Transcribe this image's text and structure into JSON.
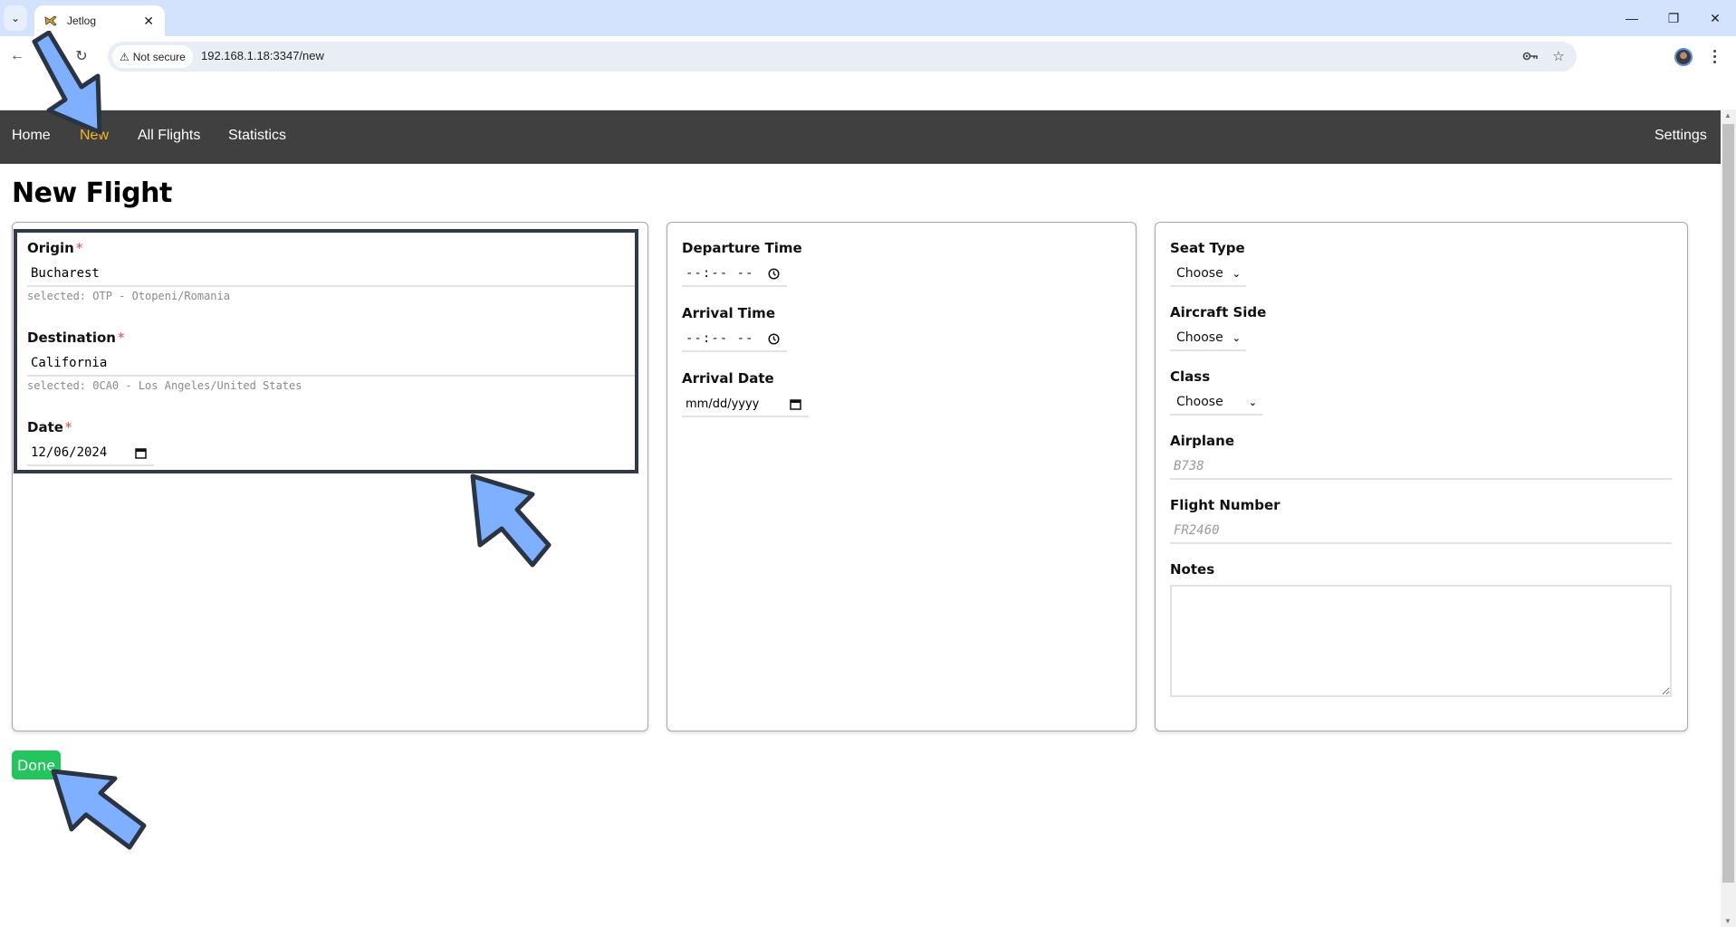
{
  "browser": {
    "tab_title": "Jetlog",
    "security_label": "Not secure",
    "url": "192.168.1.18:3347/new",
    "icons": {
      "tab_search": "chevron-down-icon",
      "tab_close": "close-icon",
      "back": "arrow-left-icon",
      "reload": "reload-icon",
      "security": "warning-triangle-icon",
      "password": "key-icon",
      "bookmark": "star-icon",
      "profile": "avatar",
      "menu": "kebab-menu-icon",
      "minimize": "minimize-icon",
      "restore": "restore-icon",
      "close_window": "close-icon"
    }
  },
  "navbar": {
    "links": [
      {
        "label": "Home",
        "active": false
      },
      {
        "label": "New",
        "active": true
      },
      {
        "label": "All Flights",
        "active": false
      },
      {
        "label": "Statistics",
        "active": false
      }
    ],
    "settings_label": "Settings",
    "active_color": "#f5b722",
    "background_color": "#404040"
  },
  "page": {
    "title": "New Flight"
  },
  "form": {
    "origin": {
      "label": "Origin",
      "required_mark": "*",
      "value": "Bucharest",
      "selected_hint": "selected: OTP - Otopeni/Romania"
    },
    "destination": {
      "label": "Destination",
      "required_mark": "*",
      "value": "California",
      "selected_hint": "selected: 0CA0 - Los Angeles/United States"
    },
    "date": {
      "label": "Date",
      "required_mark": "*",
      "value": "12/06/2024"
    },
    "departure_time": {
      "label": "Departure Time",
      "placeholder": "--:-- --"
    },
    "arrival_time": {
      "label": "Arrival Time",
      "placeholder": "--:-- --"
    },
    "arrival_date": {
      "label": "Arrival Date",
      "placeholder": "mm/dd/yyyy"
    },
    "seat_type": {
      "label": "Seat Type",
      "selected": "Choose"
    },
    "aircraft_side": {
      "label": "Aircraft Side",
      "selected": "Choose"
    },
    "class": {
      "label": "Class",
      "selected": "Choose"
    },
    "airplane": {
      "label": "Airplane",
      "placeholder": "B738",
      "value": ""
    },
    "flight_number": {
      "label": "Flight Number",
      "placeholder": "FR2460",
      "value": ""
    },
    "notes": {
      "label": "Notes",
      "value": ""
    },
    "submit_label": "Done",
    "submit_color": "#22c55e"
  }
}
